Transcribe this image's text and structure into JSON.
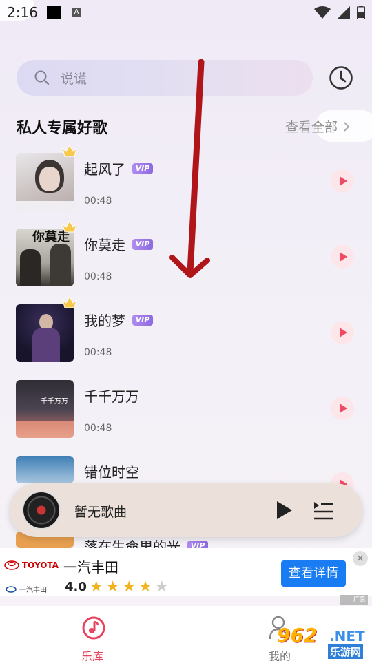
{
  "status_bar": {
    "time": "2:16",
    "a_icon": "A"
  },
  "search": {
    "placeholder": "说谎"
  },
  "section": {
    "title": "私人专属好歌",
    "see_all": "查看全部"
  },
  "songs": [
    {
      "title": "起风了",
      "duration": "00:48",
      "vip": "VIP",
      "crown": true
    },
    {
      "title": "你莫走",
      "duration": "00:48",
      "vip": "VIP",
      "crown": true
    },
    {
      "title": "我的梦",
      "duration": "00:48",
      "vip": "VIP",
      "crown": true
    },
    {
      "title": "千千万万",
      "duration": "00:48"
    },
    {
      "title": "错位时空",
      "duration": ""
    },
    {
      "title": "落在生命里的光",
      "vip": "VIP"
    }
  ],
  "cover_text": {
    "song2": "你莫走",
    "song4": "千千万万"
  },
  "player": {
    "now_playing": "暂无歌曲"
  },
  "ad": {
    "brand_logo": "TOYOTA",
    "partner_logo": "一汽丰田",
    "title": "一汽丰田",
    "rating": "4.0",
    "stars": 4,
    "button": "查看详情",
    "close": "×",
    "tag": "广告"
  },
  "nav": {
    "library": "乐库",
    "me": "我的"
  },
  "watermark": {
    "num": "962",
    "net": ".NET",
    "sub": "乐游网"
  },
  "colors": {
    "accent": "#e8435d",
    "vip": "#9b7be8",
    "ad_button": "#1a7cf2",
    "arrow": "#b0151a"
  },
  "icons": [
    "search-icon",
    "history-clock-icon",
    "chevron-right-icon",
    "crown-icon",
    "play-icon",
    "playlist-icon",
    "music-note-icon",
    "user-icon",
    "wifi-icon",
    "signal-icon",
    "battery-icon"
  ]
}
